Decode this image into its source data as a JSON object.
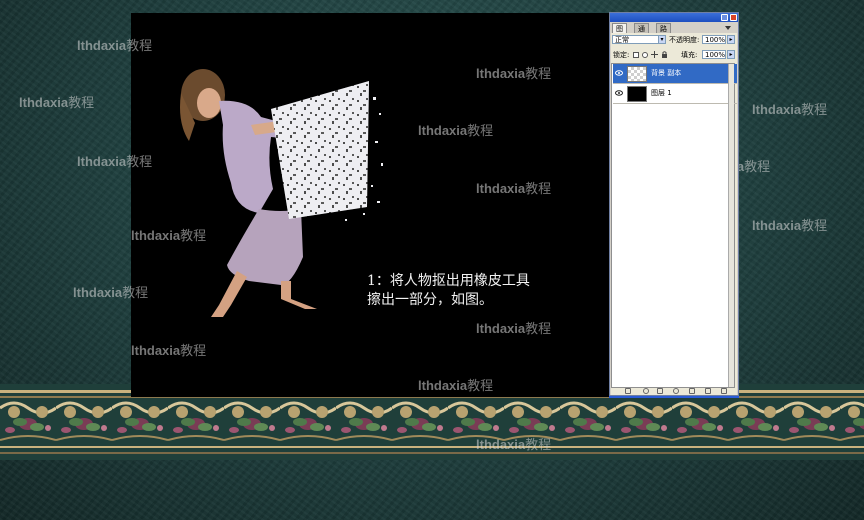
{
  "instruction": {
    "line1": "1：将人物抠出用橡皮工具",
    "line2": "擦出一部分，如图。"
  },
  "watermark": {
    "latin": "lthdaxia",
    "cn": "教程"
  },
  "layers_panel": {
    "tabs": [
      {
        "label": "图层",
        "active": true
      },
      {
        "label": "通道",
        "active": false
      },
      {
        "label": "路径",
        "active": false
      }
    ],
    "blend_mode": "正常",
    "opacity_label": "不透明度:",
    "opacity_value": "100%",
    "lock_label": "锁定:",
    "fill_label": "填充:",
    "fill_value": "100%",
    "layers": [
      {
        "name": "背景 副本",
        "selected": true
      },
      {
        "name": "图层 1",
        "selected": false
      }
    ]
  },
  "colors": {
    "selection": "#316ac5",
    "canvas": "#000000",
    "titlebar": "#1d4fc0"
  }
}
